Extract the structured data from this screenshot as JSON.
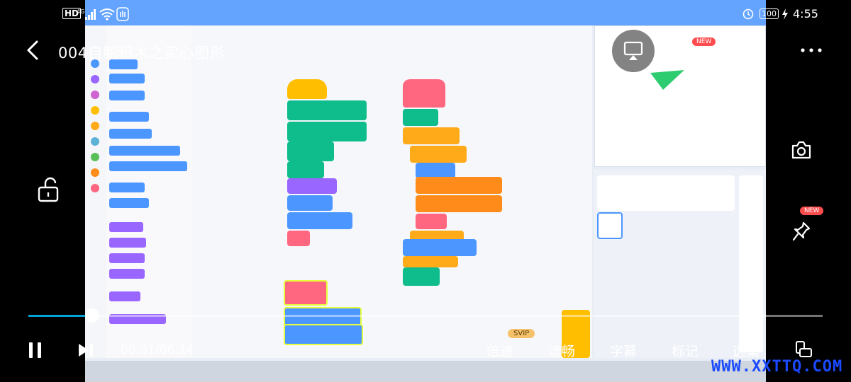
{
  "status_bar": {
    "left_icons": [
      "hd-icon",
      "4g-signal-icon",
      "wifi-icon",
      "hand-icon"
    ],
    "right_icons": [
      "alarm-icon",
      "battery-icon",
      "charging-icon"
    ],
    "battery": "100",
    "clock": "4:55"
  },
  "header": {
    "title": "004自制积木之实心图形",
    "listen_badge": "NEW"
  },
  "side_controls": {
    "lock_icon": "unlock-icon",
    "camera_icon": "camera-icon",
    "pin_badge": "NEW"
  },
  "player": {
    "progress_fraction": 0.08,
    "current_time": "00:31",
    "separator": "/",
    "duration": "06:14",
    "speed_label": "倍速",
    "speed_badge": "SVIP",
    "quality_label": "流畅",
    "subtitle_label": "字幕",
    "mark_label": "标记",
    "episodes_label": "选集"
  },
  "watermark": "WWW.XXTTQ.COM",
  "colors": {
    "progress": "#00a1d6",
    "badge": "#ff4d4f",
    "svip": "#f5c26b",
    "watermark": "#1a49ff"
  }
}
